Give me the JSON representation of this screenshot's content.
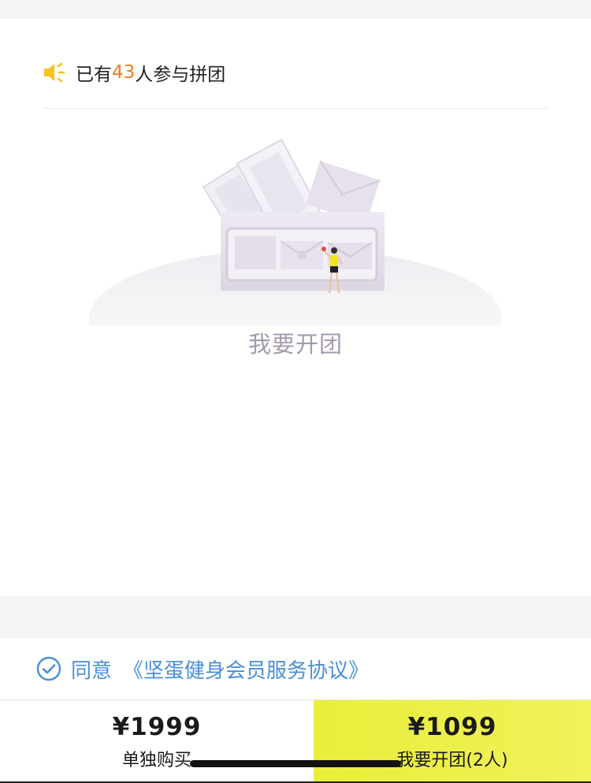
{
  "notice": {
    "prefix": "已有",
    "count": "43",
    "suffix": "人参与拼团",
    "icon": "speaker-icon"
  },
  "empty_state": {
    "text": "我要开团",
    "illustration": "empty-box-illustration"
  },
  "agreement": {
    "label": "同意",
    "link": "《坚蛋健身会员服务协议》",
    "checked": true,
    "icon": "check-circle-icon"
  },
  "purchase": {
    "single": {
      "price": "¥1999",
      "label": "单独购买"
    },
    "group": {
      "price": "¥1099",
      "label": "我要开团(2人)"
    }
  },
  "colors": {
    "accent_orange": "#f07b22",
    "link_blue": "#4a8fd9",
    "group_button_yellow": "#eaf046",
    "speaker_yellow": "#f5c518",
    "empty_text": "#a49aae"
  }
}
